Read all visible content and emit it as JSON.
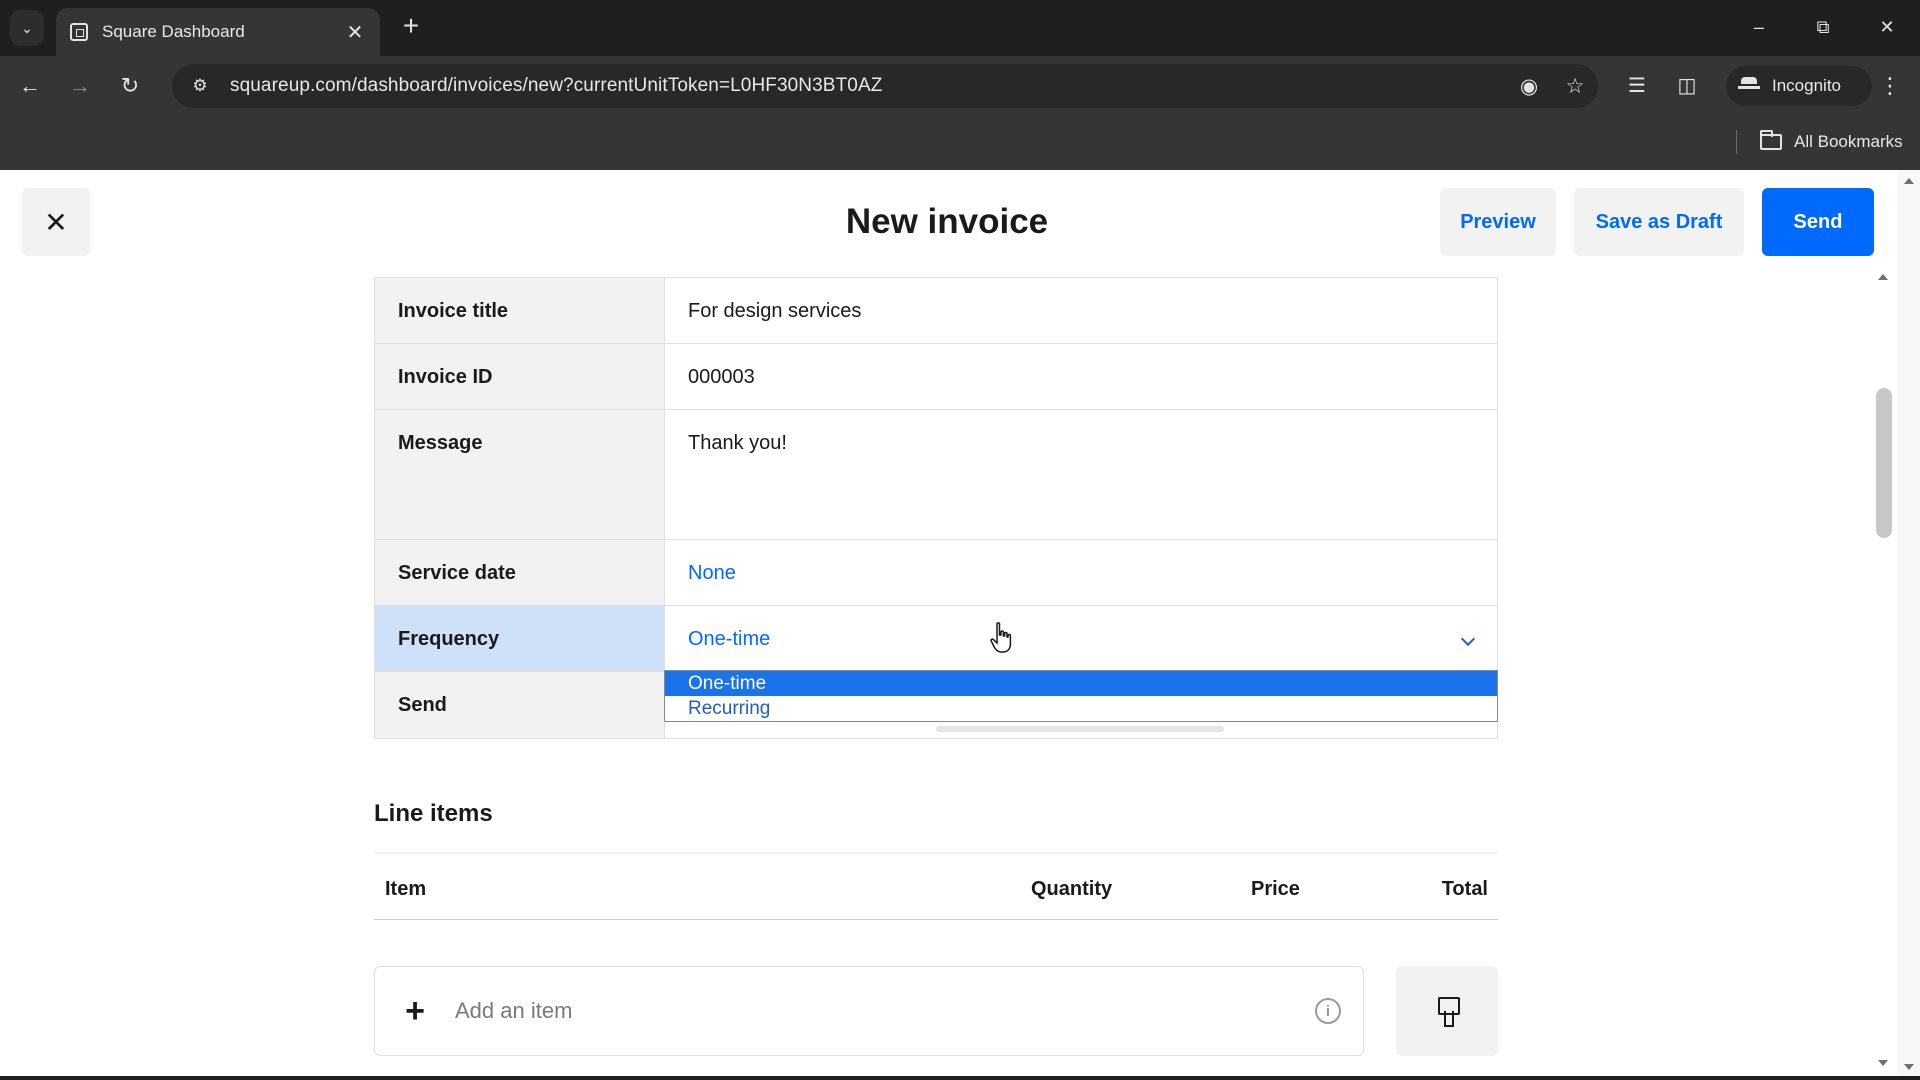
{
  "browser": {
    "tab_title": "Square Dashboard",
    "url": "squareup.com/dashboard/invoices/new?currentUnitToken=L0HF30N3BT0AZ",
    "incognito_label": "Incognito",
    "all_bookmarks": "All Bookmarks"
  },
  "header": {
    "title": "New invoice",
    "preview": "Preview",
    "save_draft": "Save as Draft",
    "send": "Send"
  },
  "form": {
    "invoice_title": {
      "label": "Invoice title",
      "value": "For design services"
    },
    "invoice_id": {
      "label": "Invoice ID",
      "value": "000003"
    },
    "message": {
      "label": "Message",
      "value": "Thank you!"
    },
    "service_date": {
      "label": "Service date",
      "value": "None"
    },
    "frequency": {
      "label": "Frequency",
      "value": "One-time",
      "options": [
        "One-time",
        "Recurring"
      ]
    },
    "send": {
      "label": "Send"
    }
  },
  "line_items": {
    "title": "Line items",
    "columns": {
      "item": "Item",
      "quantity": "Quantity",
      "price": "Price",
      "total": "Total"
    },
    "add_placeholder": "Add an item"
  },
  "colors": {
    "accent": "#006aff",
    "selected_option": "#1a73e8",
    "active_row": "#cfe0f9"
  }
}
